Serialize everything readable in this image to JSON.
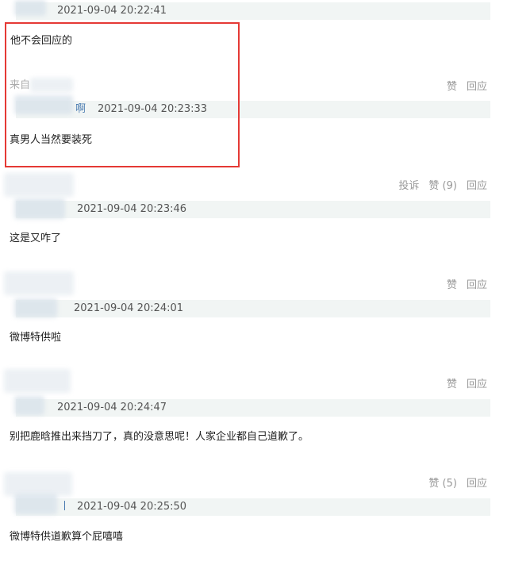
{
  "comments": [
    {
      "timestamp": "2021-09-04 20:22:41",
      "text": "他不会回应的",
      "source": "来自",
      "actions": [
        "赞",
        "回应"
      ]
    },
    {
      "username": "啊",
      "timestamp": "2021-09-04 20:23:33",
      "text": "真男人当然要装死",
      "actions": [
        "投诉",
        "赞 (9)",
        "回应"
      ]
    },
    {
      "timestamp": "2021-09-04 20:23:46",
      "text": "这是又咋了",
      "actions": [
        "赞",
        "回应"
      ]
    },
    {
      "timestamp": "2021-09-04 20:24:01",
      "text": "微博特供啦",
      "actions": [
        "赞",
        "回应"
      ]
    },
    {
      "timestamp": "2021-09-04 20:24:47",
      "text": "别把鹿晗推出来挡刀了，真的没意思呢！人家企业都自己道歉了。",
      "actions": [
        "赞 (5)",
        "回应"
      ]
    },
    {
      "username": "丨",
      "timestamp": "2021-09-04 20:25:50",
      "text": "微博特供道歉算个屁嘻嘻"
    }
  ],
  "colors": {
    "highlight": "#e53935",
    "meta_band": "#f1f5f4",
    "action_text": "#999999",
    "username": "#4a7bb0"
  }
}
